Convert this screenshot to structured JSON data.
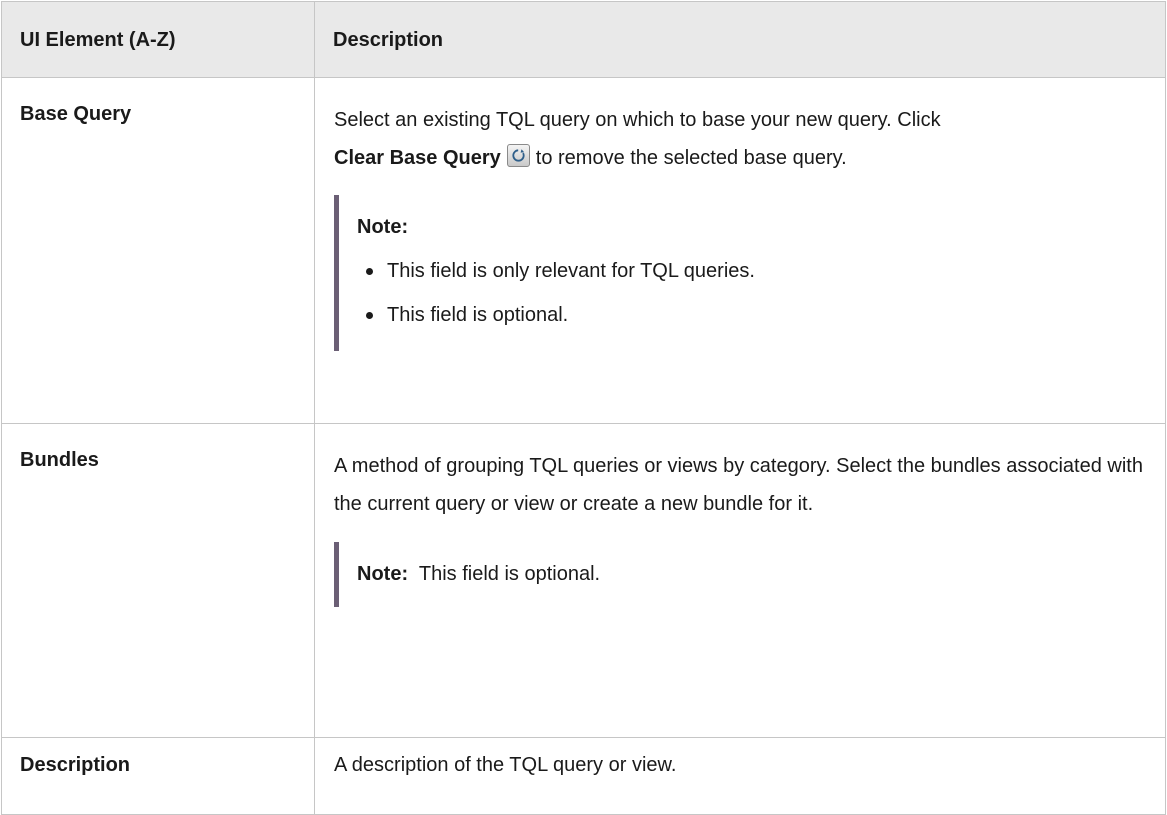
{
  "table": {
    "headers": {
      "element": "UI Element (A-Z)",
      "description": "Description"
    },
    "rows": [
      {
        "element": "Base Query",
        "desc_part1": "Select an existing TQL query on which to base your new query. Click",
        "desc_bold": "Clear Base Query",
        "desc_part2": "to remove the selected base query.",
        "icon": "clear-base-query-icon",
        "note_title": "Note:",
        "note_bullets": [
          "This field is only relevant for TQL queries.",
          "This field is optional."
        ]
      },
      {
        "element": "Bundles",
        "desc": "A method of grouping TQL queries or views by category. Select the bundles associated with the current query or view or create a new bundle for it.",
        "note_label": "Note:",
        "note_text": "This field is optional."
      },
      {
        "element": "Description",
        "desc": "A description of the TQL query or view."
      }
    ]
  },
  "colors": {
    "header_bg": "#e9e9e9",
    "border": "#c6c6c6",
    "note_bar": "#6b5f75"
  }
}
